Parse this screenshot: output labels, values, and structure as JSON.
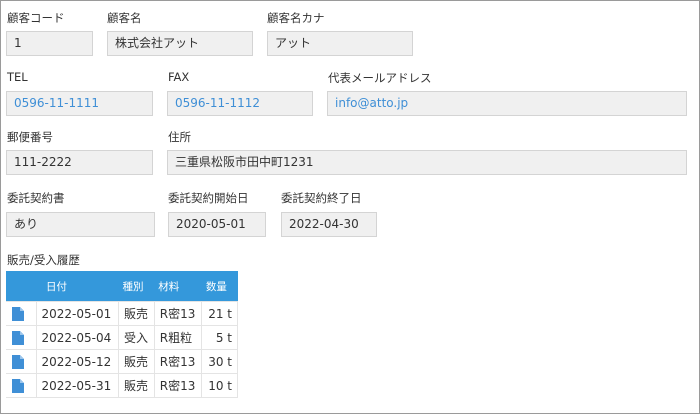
{
  "customer": {
    "code_label": "顧客コード",
    "code": "1",
    "name_label": "顧客名",
    "name": "株式会社アット",
    "kana_label": "顧客名カナ",
    "kana": "アット"
  },
  "contact": {
    "tel_label": "TEL",
    "tel": "0596-11-1111",
    "fax_label": "FAX",
    "fax": "0596-11-1112",
    "email_label": "代表メールアドレス",
    "email": "info@atto.jp"
  },
  "address": {
    "postal_label": "郵便番号",
    "postal": "111-2222",
    "address_label": "住所",
    "address": "三重県松阪市田中町1231"
  },
  "contract": {
    "doc_label": "委託契約書",
    "doc": "あり",
    "start_label": "委託契約開始日",
    "start": "2020-05-01",
    "end_label": "委託契約終了日",
    "end": "2022-04-30"
  },
  "history": {
    "title": "販売/受入履歴",
    "headers": {
      "date": "日付",
      "type": "種別",
      "material": "材料",
      "qty": "数量"
    },
    "rows": [
      {
        "icon": "document-icon",
        "date": "2022-05-01",
        "type": "販売",
        "material": "R密13",
        "qty": "21 t"
      },
      {
        "icon": "document-icon",
        "date": "2022-05-04",
        "type": "受入",
        "material": "R粗粒",
        "qty": "5 t"
      },
      {
        "icon": "document-icon",
        "date": "2022-05-12",
        "type": "販売",
        "material": "R密13",
        "qty": "30 t"
      },
      {
        "icon": "document-icon",
        "date": "2022-05-31",
        "type": "販売",
        "material": "R密13",
        "qty": "10 t"
      }
    ]
  },
  "colors": {
    "accent": "#3498db",
    "link": "#3f8fd6",
    "field_bg": "#f0f0f0"
  }
}
